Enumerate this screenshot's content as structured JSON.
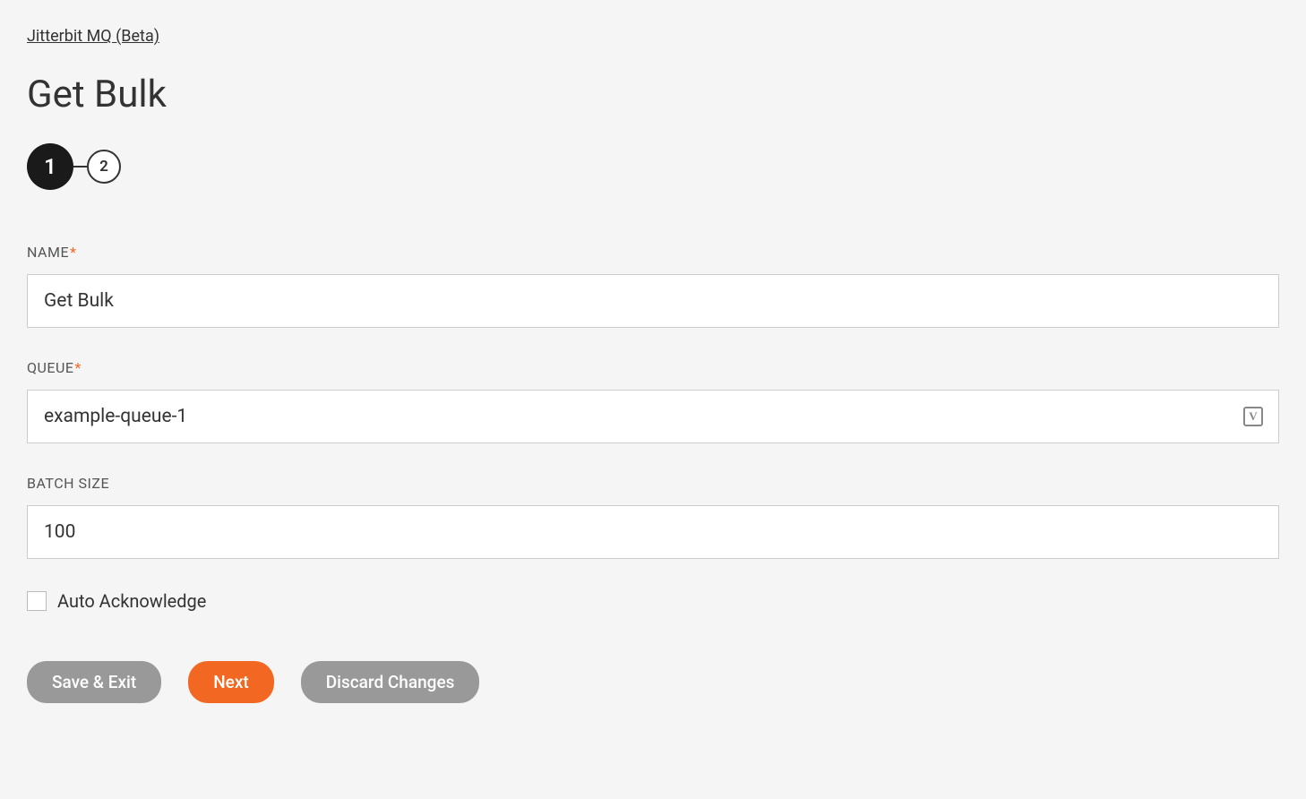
{
  "breadcrumb": "Jitterbit MQ (Beta)",
  "title": "Get Bulk",
  "stepper": {
    "step1": "1",
    "step2": "2"
  },
  "form": {
    "name": {
      "label": "NAME",
      "value": "Get Bulk"
    },
    "queue": {
      "label": "QUEUE",
      "value": "example-queue-1",
      "icon_label": "V"
    },
    "batch_size": {
      "label": "BATCH SIZE",
      "value": "100"
    },
    "auto_ack": {
      "label": "Auto Acknowledge",
      "checked": false
    }
  },
  "buttons": {
    "save_exit": "Save & Exit",
    "next": "Next",
    "discard": "Discard Changes"
  }
}
